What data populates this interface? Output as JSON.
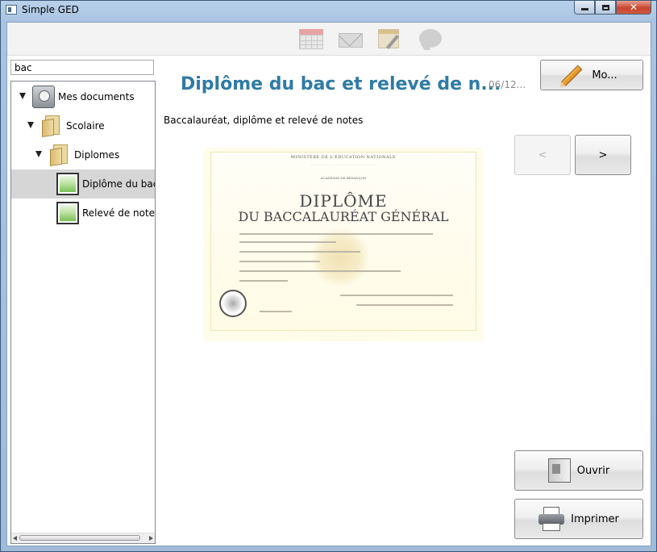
{
  "window": {
    "title": "Simple GED"
  },
  "toolbar": {
    "icons": [
      "calendar-icon",
      "mail-icon",
      "notepad-icon",
      "chat-icon"
    ]
  },
  "search": {
    "value": "bac"
  },
  "tree": {
    "items": [
      {
        "label": "Mes documents",
        "icon": "drive-icon",
        "level": 0,
        "expanded": true
      },
      {
        "label": "Scolaire",
        "icon": "folder-icon",
        "level": 1,
        "expanded": true
      },
      {
        "label": "Diplomes",
        "icon": "folder-icon",
        "level": 2,
        "expanded": true
      },
      {
        "label": "Diplôme du bac.jpg",
        "icon": "image-icon",
        "level": 3,
        "selected": true
      },
      {
        "label": "Relevé de notes du bac.jpg",
        "icon": "image-icon",
        "level": 3
      }
    ]
  },
  "document": {
    "title": "Diplôme du bac et relevé de n...",
    "date": "06/12...",
    "description": "Baccalauréat, diplôme et relevé de notes",
    "preview": {
      "header": "MINISTÈRE DE L'ÉDUCATION NATIONALE",
      "line1": "ACADÉMIE DE BESANÇON",
      "title_line1": "DIPLÔME",
      "title_line2": "DU BACCALAURÉAT GÉNÉRAL"
    }
  },
  "buttons": {
    "modify": "Mo...",
    "prev": "<",
    "next": ">",
    "open": "Ouvrir",
    "print": "Imprimer"
  },
  "colors": {
    "accent": "#2e7ba6"
  }
}
